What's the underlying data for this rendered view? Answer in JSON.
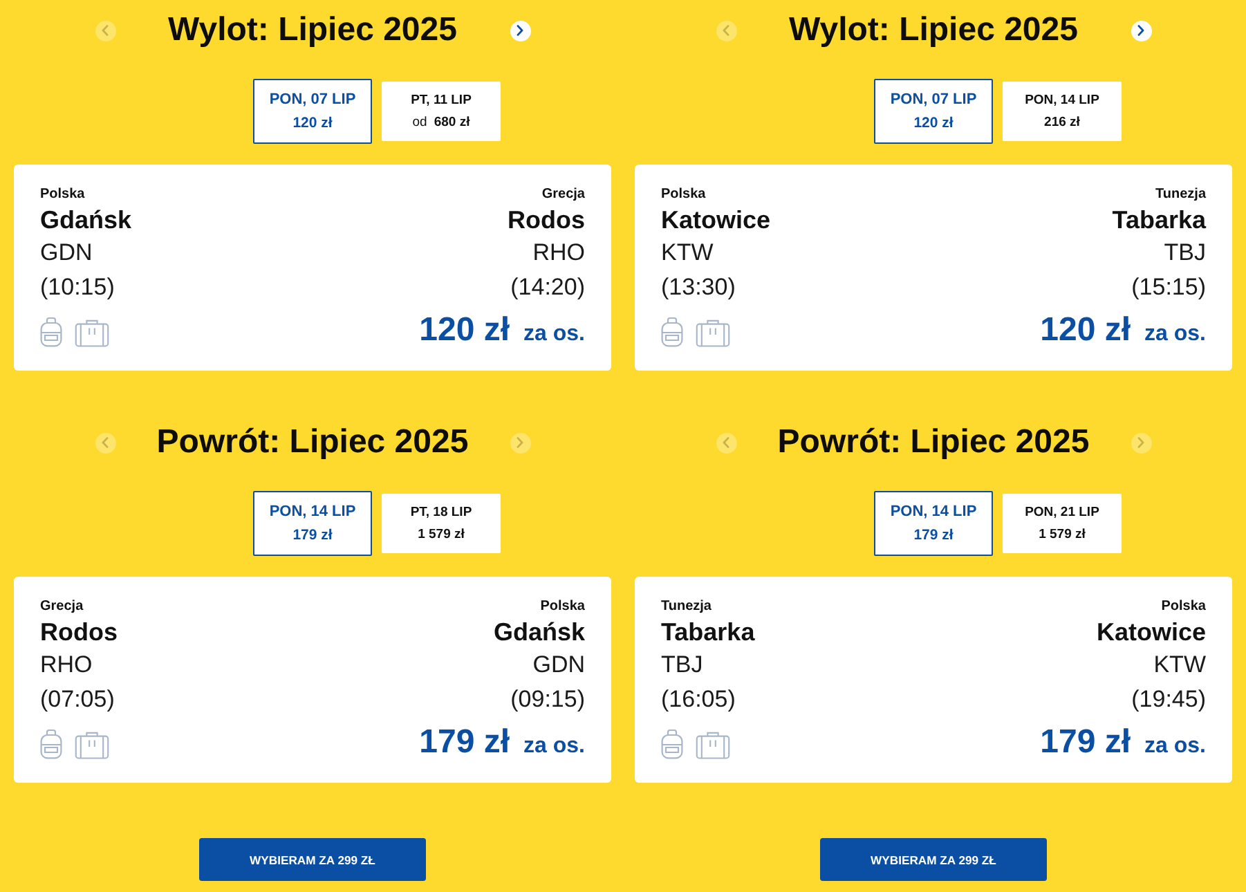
{
  "offers": [
    {
      "legs": [
        {
          "title": "Wylot: Lipiec 2025",
          "prev": {
            "disabled": true
          },
          "next": {
            "disabled": false
          },
          "dates": [
            {
              "day": "PON, 07 LIP",
              "price": "120 zł",
              "selected": true
            },
            {
              "day": "PT, 11 LIP",
              "price_prefix": "od",
              "price": "680 zł",
              "selected": false
            }
          ],
          "flight": {
            "from": {
              "country": "Polska",
              "city": "Gdańsk",
              "code": "GDN",
              "time": "(10:15)"
            },
            "to": {
              "country": "Grecja",
              "city": "Rodos",
              "code": "RHO",
              "time": "(14:20)"
            },
            "price": "120 zł",
            "per": "za os."
          }
        },
        {
          "title": "Powrót: Lipiec 2025",
          "prev": {
            "disabled": true
          },
          "next": {
            "disabled": true
          },
          "dates": [
            {
              "day": "PON, 14 LIP",
              "price": "179 zł",
              "selected": true
            },
            {
              "day": "PT, 18 LIP",
              "price": "1 579 zł",
              "selected": false
            }
          ],
          "flight": {
            "from": {
              "country": "Grecja",
              "city": "Rodos",
              "code": "RHO",
              "time": "(07:05)"
            },
            "to": {
              "country": "Polska",
              "city": "Gdańsk",
              "code": "GDN",
              "time": "(09:15)"
            },
            "price": "179 zł",
            "per": "za os."
          }
        }
      ],
      "button": "WYBIERAM ZA 299 ZŁ"
    },
    {
      "legs": [
        {
          "title": "Wylot: Lipiec 2025",
          "prev": {
            "disabled": true
          },
          "next": {
            "disabled": false
          },
          "dates": [
            {
              "day": "PON, 07 LIP",
              "price": "120 zł",
              "selected": true
            },
            {
              "day": "PON, 14 LIP",
              "price": "216 zł",
              "selected": false
            }
          ],
          "flight": {
            "from": {
              "country": "Polska",
              "city": "Katowice",
              "code": "KTW",
              "time": "(13:30)"
            },
            "to": {
              "country": "Tunezja",
              "city": "Tabarka",
              "code": "TBJ",
              "time": "(15:15)"
            },
            "price": "120 zł",
            "per": "za os."
          }
        },
        {
          "title": "Powrót: Lipiec 2025",
          "prev": {
            "disabled": true
          },
          "next": {
            "disabled": true
          },
          "dates": [
            {
              "day": "PON, 14 LIP",
              "price": "179 zł",
              "selected": true
            },
            {
              "day": "PON, 21 LIP",
              "price": "1 579 zł",
              "selected": false
            }
          ],
          "flight": {
            "from": {
              "country": "Tunezja",
              "city": "Tabarka",
              "code": "TBJ",
              "time": "(16:05)"
            },
            "to": {
              "country": "Polska",
              "city": "Katowice",
              "code": "KTW",
              "time": "(19:45)"
            },
            "price": "179 zł",
            "per": "za os."
          }
        }
      ],
      "button": "WYBIERAM ZA 299 ZŁ"
    }
  ]
}
